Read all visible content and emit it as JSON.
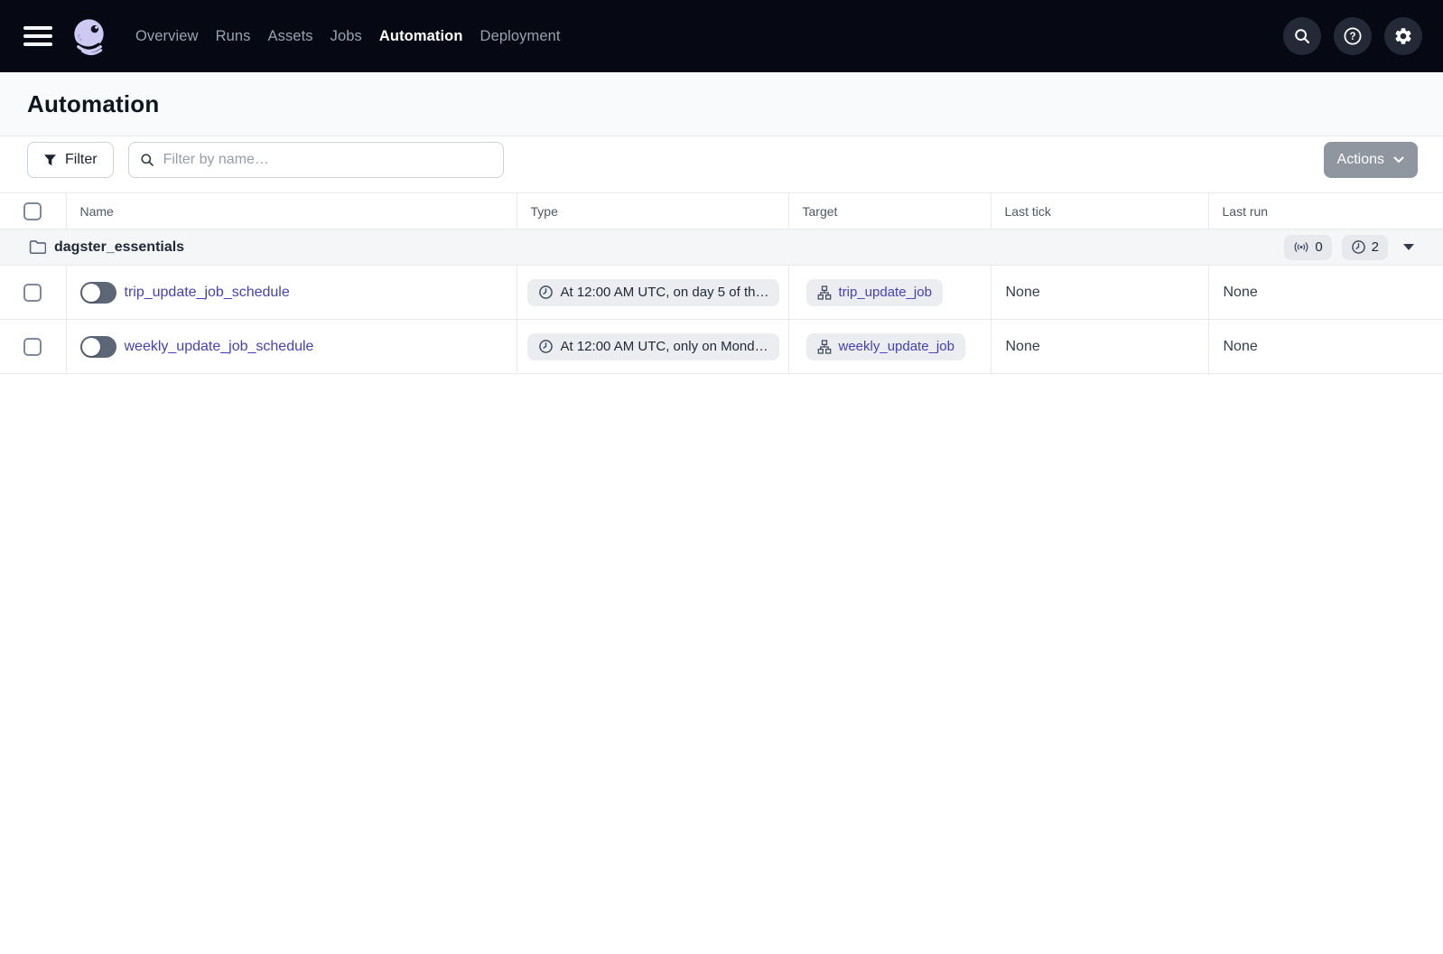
{
  "navbar": {
    "items": [
      {
        "label": "Overview",
        "active": false
      },
      {
        "label": "Runs",
        "active": false
      },
      {
        "label": "Assets",
        "active": false
      },
      {
        "label": "Jobs",
        "active": false
      },
      {
        "label": "Automation",
        "active": true
      },
      {
        "label": "Deployment",
        "active": false
      }
    ],
    "icons": {
      "menu": "hamburger",
      "logo": "dagster-octopus",
      "right": [
        "search",
        "help",
        "settings-gear"
      ]
    }
  },
  "page": {
    "title": "Automation"
  },
  "toolbar": {
    "filter_label": "Filter",
    "search_placeholder": "Filter by name…",
    "actions_label": "Actions"
  },
  "table": {
    "columns": [
      "Name",
      "Type",
      "Target",
      "Last tick",
      "Last run"
    ],
    "group": {
      "name": "dagster_essentials",
      "sensor_count": "0",
      "schedule_count": "2"
    },
    "rows": [
      {
        "name": "trip_update_job_schedule",
        "enabled": false,
        "type": "At 12:00 AM UTC, on day 5 of th…",
        "target": "trip_update_job",
        "last_tick": "None",
        "last_run": "None"
      },
      {
        "name": "weekly_update_job_schedule",
        "enabled": false,
        "type": "At 12:00 AM UTC, only on Mond…",
        "target": "weekly_update_job",
        "last_tick": "None",
        "last_run": "None"
      }
    ]
  },
  "colors": {
    "navbar_bg": "#060913",
    "link": "#4540C0",
    "logo_lavender": "#CEC9F3",
    "group_row_bg": "#F5F6F8",
    "pill_bg": "#EBEDF0",
    "actions_bg": "#8F96A0"
  }
}
